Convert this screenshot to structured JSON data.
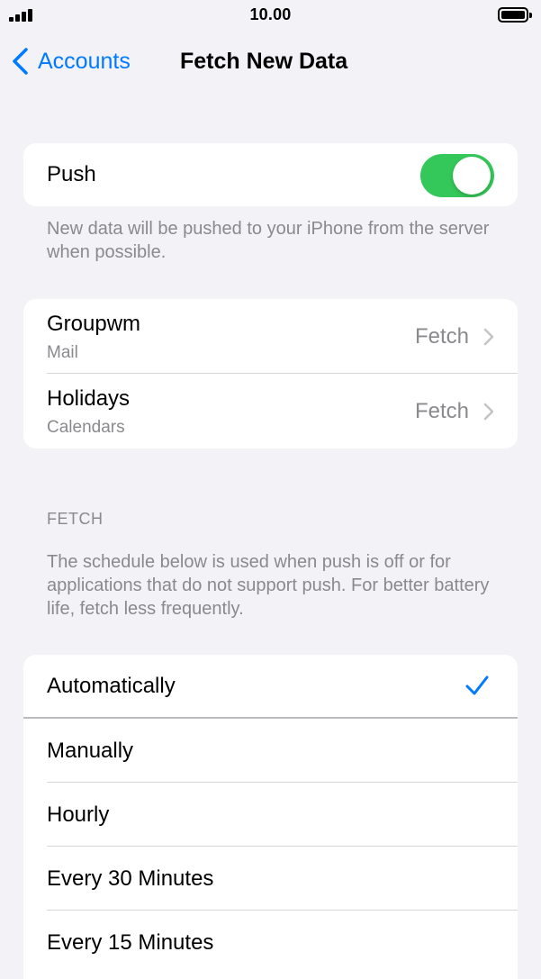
{
  "status_bar": {
    "time": "10.00"
  },
  "nav": {
    "back_label": "Accounts",
    "title": "Fetch New Data"
  },
  "push": {
    "label": "Push",
    "enabled": true,
    "footnote": "New data will be pushed to your iPhone from the server when possible."
  },
  "accounts": [
    {
      "name": "Groupwm",
      "type": "Mail",
      "value": "Fetch"
    },
    {
      "name": "Holidays",
      "type": "Calendars",
      "value": "Fetch"
    }
  ],
  "fetch": {
    "header": "FETCH",
    "footnote": "The schedule below is used when push is off or for applications that do not support push. For better battery life, fetch less frequently.",
    "options": [
      {
        "label": "Automatically",
        "selected": true
      },
      {
        "label": "Manually",
        "selected": false
      },
      {
        "label": "Hourly",
        "selected": false
      },
      {
        "label": "Every 30 Minutes",
        "selected": false
      },
      {
        "label": "Every 15 Minutes",
        "selected": false
      }
    ]
  },
  "colors": {
    "accent": "#007aff",
    "toggle_on": "#34c759",
    "background": "#f2f2f7"
  }
}
